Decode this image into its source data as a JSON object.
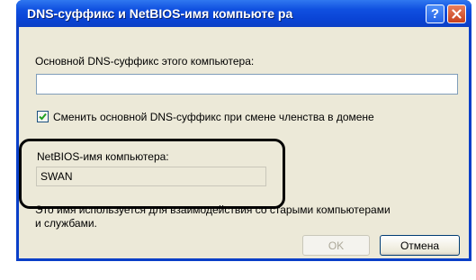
{
  "dialog": {
    "title": "DNS-суффикс и NetBIOS-имя компьюте ра",
    "help_glyph": "?",
    "primary_dns_label": "Основной DNS-суффикс этого компьютера:",
    "primary_dns_value": "",
    "change_suffix_checkbox": {
      "label": "Сменить основной DNS-суффикс при смене членства в домене",
      "checked": true
    },
    "netbios_label": "NetBIOS-имя компьютера:",
    "netbios_value": "SWAN",
    "info_text_line1": "Это имя используется для взаимодействия со старыми компьютерами",
    "info_text_line2": "и службами.",
    "ok_label": "OK",
    "cancel_label": "Отмена"
  },
  "colors": {
    "titlebar": "#0a44d6",
    "body": "#ece9d8",
    "input_border": "#7f9db9",
    "close_button": "#c7401c"
  },
  "icons": [
    "help-icon",
    "close-icon",
    "checkmark-icon"
  ]
}
